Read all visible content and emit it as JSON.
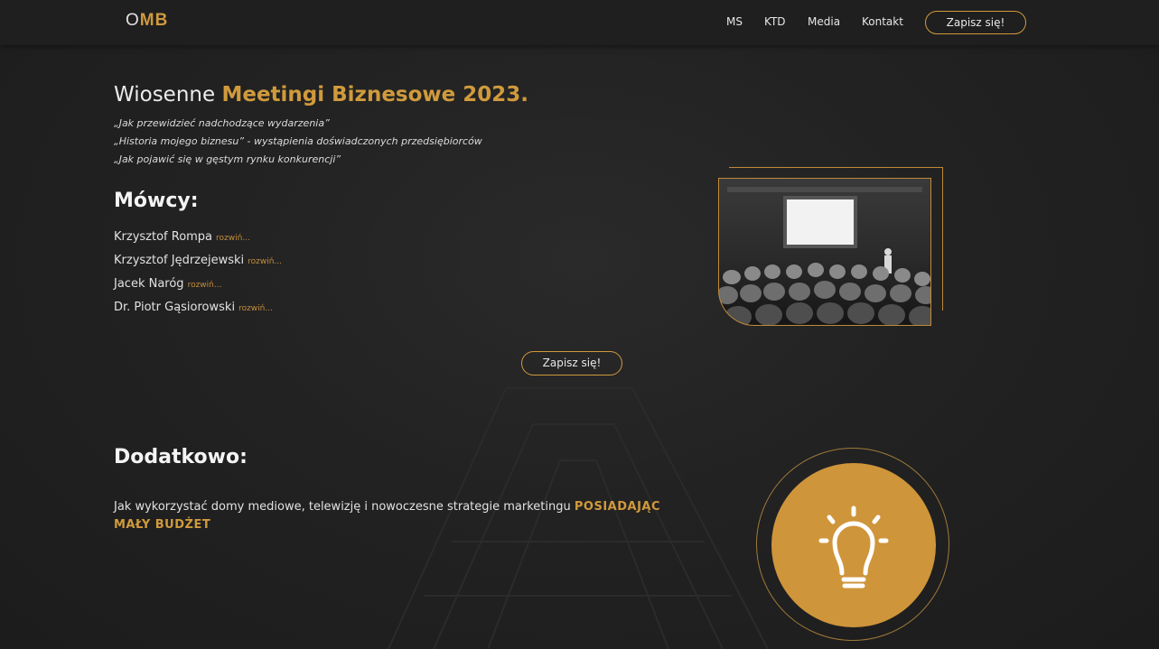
{
  "logo": {
    "o": "O",
    "mb": "MB"
  },
  "nav": {
    "items": [
      "MS",
      "KTD",
      "Media",
      "Kontakt"
    ],
    "signup": "Zapisz się!"
  },
  "hero": {
    "title_plain": "Wiosenne ",
    "title_accent": "Meetingi Biznesowe 2023.",
    "quotes": [
      "„Jak przewidzieć nadchodzące wydarzenia”",
      "„Historia mojego biznesu” - wystąpienia doświadczonych przedsiębiorców",
      "„Jak pojawić się w gęstym rynku konkurencji”"
    ]
  },
  "speakers": {
    "heading": "Mówcy:",
    "more_label": "rozwiń...",
    "list": [
      "Krzysztof Rompa",
      "Krzysztof Jędrzejewski",
      "Jacek Naróg",
      "Dr. Piotr Gąsiorowski"
    ]
  },
  "cta": {
    "label": "Zapisz się!"
  },
  "extra": {
    "heading": "Dodatkowo:",
    "text": "Jak wykorzystać domy mediowe, telewizję i nowoczesne strategie marketingu ",
    "accent": "POSIADAJĄC MAŁY BUDŻET"
  },
  "images": {
    "photo": "conference-audience-photo",
    "icon": "lightbulb-icon"
  },
  "colors": {
    "accent": "#d09a3c",
    "background": "#222222",
    "topbar": "#1f1f1f"
  }
}
